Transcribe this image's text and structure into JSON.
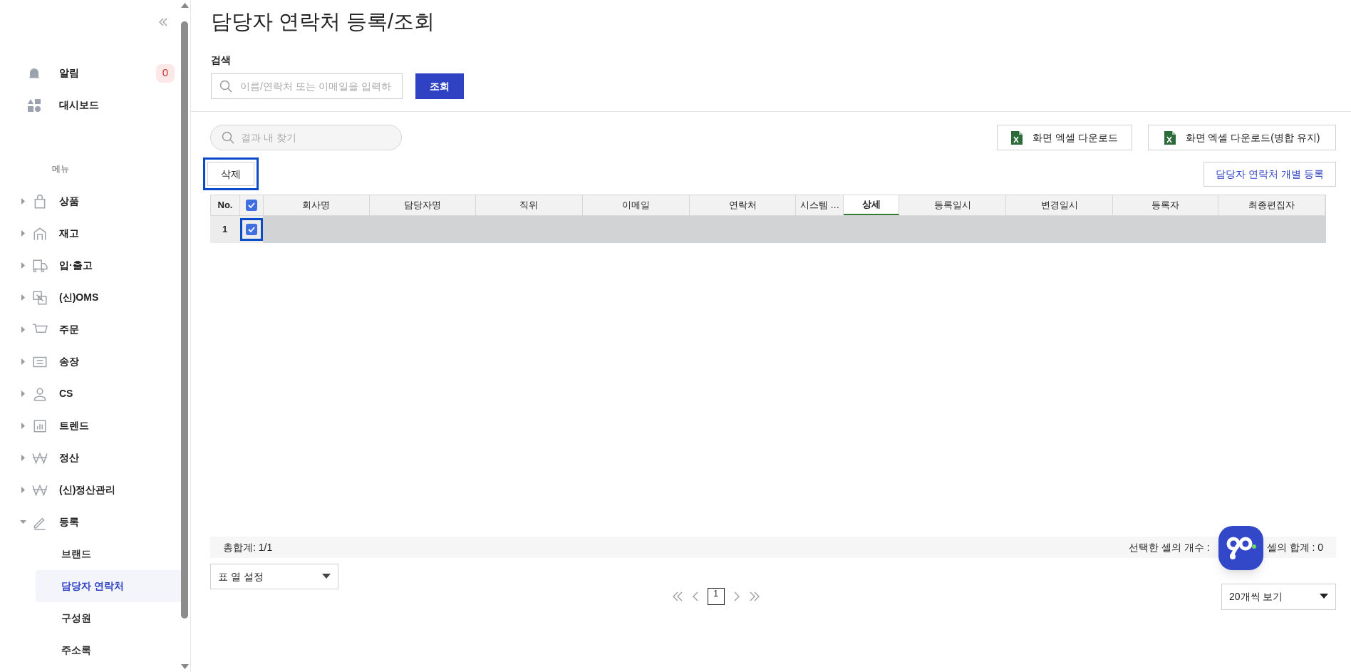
{
  "sidebar": {
    "notifications": {
      "label": "알림",
      "count": "0"
    },
    "dashboard": {
      "label": "대시보드"
    },
    "menu_heading": "메뉴",
    "menu": [
      {
        "label": "상품",
        "expanded": false
      },
      {
        "label": "재고",
        "expanded": false
      },
      {
        "label": "입·출고",
        "expanded": false
      },
      {
        "label": "(신)OMS",
        "expanded": false
      },
      {
        "label": "주문",
        "expanded": false
      },
      {
        "label": "송장",
        "expanded": false
      },
      {
        "label": "CS",
        "expanded": false
      },
      {
        "label": "트렌드",
        "expanded": false
      },
      {
        "label": "정산",
        "expanded": false
      },
      {
        "label": "(신)정산관리",
        "expanded": false
      },
      {
        "label": "등록",
        "expanded": true,
        "children": [
          {
            "label": "브랜드",
            "selected": false
          },
          {
            "label": "담당자 연락처",
            "selected": true
          },
          {
            "label": "구성원",
            "selected": false
          },
          {
            "label": "주소록",
            "selected": false
          }
        ]
      }
    ]
  },
  "page": {
    "title": "담당자 연락처 등록/조회",
    "search": {
      "label": "검색",
      "placeholder": "이름/연락처 또는 이메일을 입력하",
      "button": "조회"
    },
    "result_search": {
      "placeholder": "결과 내 찾기"
    },
    "excel_buttons": [
      "화면 엑셀 다운로드",
      "화면 엑셀 다운로드(병합 유지)"
    ],
    "delete_button": {
      "label": "삭제",
      "highlighted": true
    },
    "register_button": "담당자 연락처 개별 등록",
    "table": {
      "header_checked": true,
      "columns": [
        {
          "label": "No.",
          "selected": false
        },
        {
          "label": "회사명",
          "selected": false
        },
        {
          "label": "담당자명",
          "selected": false
        },
        {
          "label": "직위",
          "selected": false
        },
        {
          "label": "이메일",
          "selected": false
        },
        {
          "label": "연락처",
          "selected": false
        },
        {
          "label": "시스템 …",
          "selected": false
        },
        {
          "label": "상세",
          "selected": true
        },
        {
          "label": "등록일시",
          "selected": false
        },
        {
          "label": "변경일시",
          "selected": false
        },
        {
          "label": "등록자",
          "selected": false
        },
        {
          "label": "최종편집자",
          "selected": false
        }
      ],
      "rows": [
        {
          "no": "1",
          "checked": true,
          "selected": true,
          "highlighted": true
        }
      ]
    },
    "summary": {
      "total": "총합계: 1/1",
      "selected_count": "선택한 셀의 개수 : ",
      "sum": "셀의 합계 : 0"
    },
    "column_settings": "표 열 설정",
    "pagination": {
      "pages": [
        {
          "label": "1",
          "selected": true
        }
      ]
    },
    "page_size": "20개씩 보기"
  }
}
